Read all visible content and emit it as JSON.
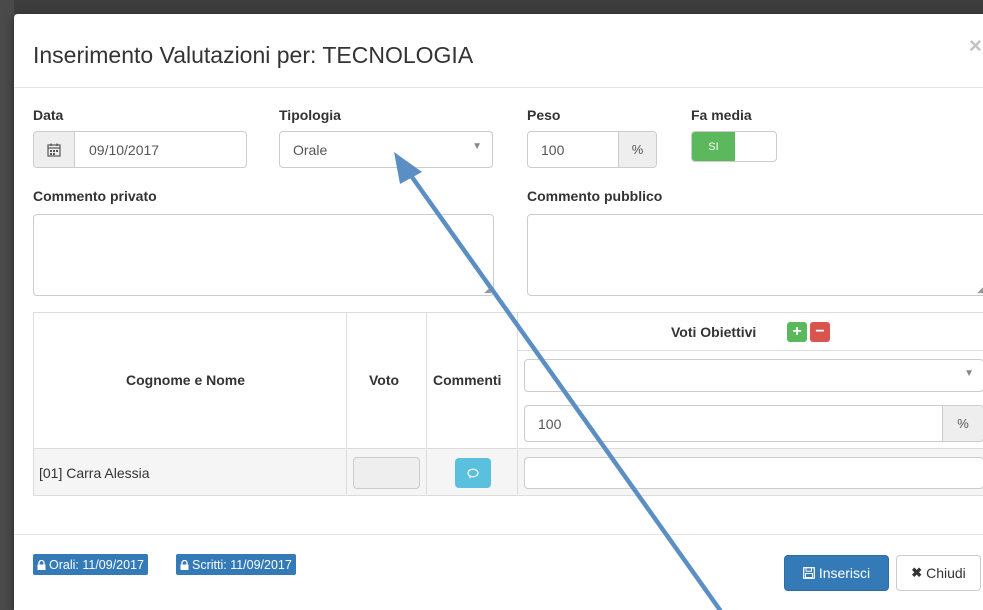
{
  "modal": {
    "title": "Inserimento Valutazioni per: TECNOLOGIA",
    "close_glyph": "×"
  },
  "form": {
    "data_label": "Data",
    "data_value": "09/10/2017",
    "tipologia_label": "Tipologia",
    "tipologia_value": "Orale",
    "peso_label": "Peso",
    "peso_value": "100",
    "peso_unit": "%",
    "fa_media_label": "Fa media",
    "fa_media_on": "SI",
    "commento_privato_label": "Commento privato",
    "commento_pubblico_label": "Commento pubblico"
  },
  "grid": {
    "col_name": "Cognome e Nome",
    "col_voto": "Voto",
    "col_commenti": "Commenti",
    "col_obiettivi": "Voti Obiettivi",
    "obiettivo_weight": "100",
    "obiettivo_unit": "%",
    "rows": [
      {
        "name": "[01] Carra Alessia"
      }
    ]
  },
  "footer": {
    "badge_orali": "Orali: 11/09/2017",
    "badge_scritti": "Scritti: 11/09/2017",
    "insert_label": "Inserisci",
    "close_label": "Chiudi"
  },
  "colors": {
    "primary": "#337ab7",
    "success": "#5cb85c",
    "danger": "#d9534f",
    "info": "#5bc0de",
    "annotation_arrow": "#5b8fc4"
  },
  "icons": [
    "calendar-icon",
    "chevron-down-icon",
    "plus-icon",
    "minus-icon",
    "comment-icon",
    "lock-icon",
    "save-icon",
    "close-icon"
  ]
}
